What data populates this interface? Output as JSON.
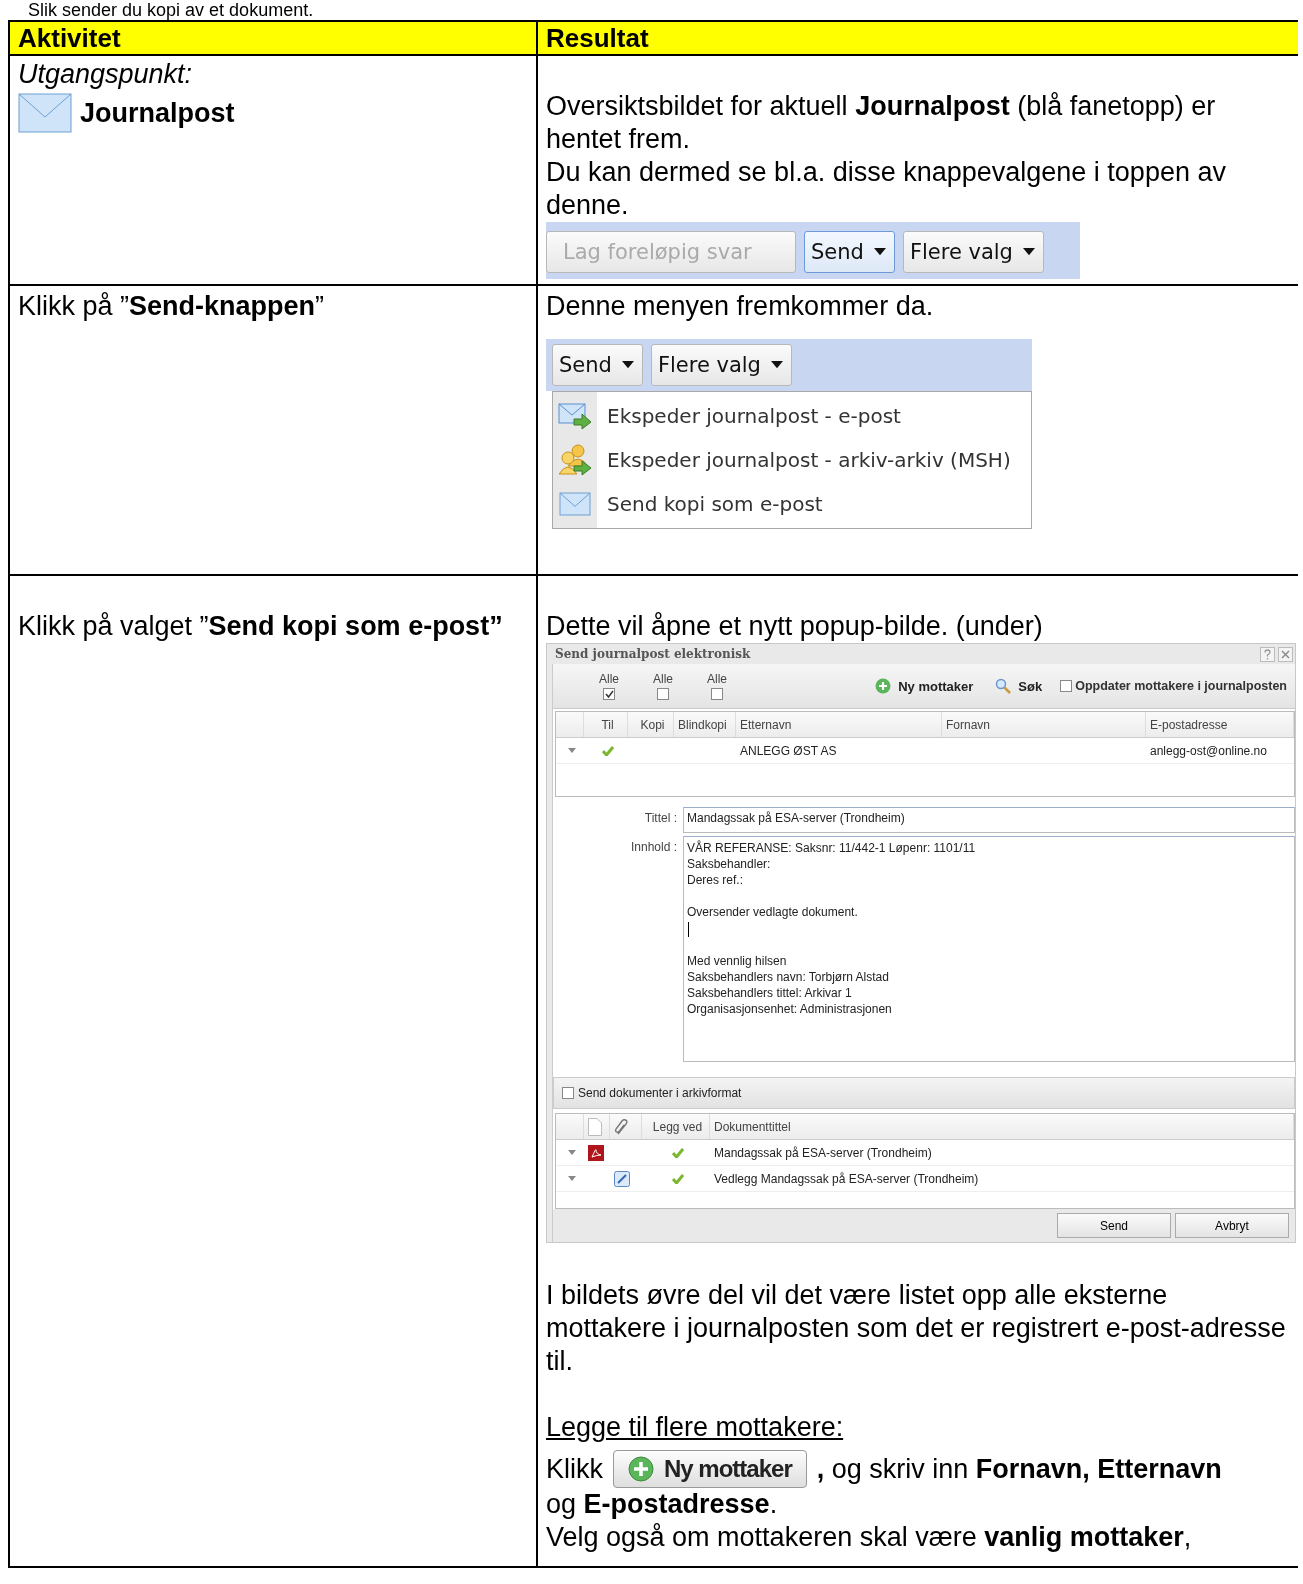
{
  "intro": "Slik sender du kopi av et dokument.",
  "table": {
    "columns": [
      "Aktivitet",
      "Resultat"
    ],
    "rows": [
      {
        "kind": "start",
        "activity": {
          "label": "Utgangspunkt:",
          "item": "Journalpost"
        },
        "result": {
          "paragraphs": [
            "Oversiktsbildet for aktuell **Journalpost** (blå fanetopp) er hentet frem.",
            "Du kan dermed se bl.a. disse knappevalgene i toppen av denne."
          ],
          "toolbar": [
            {
              "label": "Lag foreløpig svar",
              "disabled": true,
              "focused": false,
              "dropdown": false
            },
            {
              "label": "Send",
              "disabled": false,
              "focused": true,
              "dropdown": true
            },
            {
              "label": "Flere valg",
              "disabled": false,
              "focused": false,
              "dropdown": true
            }
          ]
        }
      },
      {
        "kind": "menu",
        "activity": {
          "text": "Klikk på ”**Send-knappen**”"
        },
        "result": {
          "paragraphs": [
            "Denne menyen fremkommer da."
          ],
          "toolbar": [
            {
              "label": "Send",
              "dropdown": true
            },
            {
              "label": "Flere valg",
              "dropdown": true
            }
          ],
          "menu": [
            {
              "kind": "mail-send",
              "label": "Ekspeder journalpost - e-post"
            },
            {
              "kind": "archive-send",
              "label": "Ekspeder journalpost - arkiv-arkiv (MSH)"
            },
            {
              "kind": "mail",
              "label": "Send kopi som e-post"
            }
          ]
        }
      },
      {
        "kind": "dialog",
        "activity": {
          "text": "Klikk på valget ”**Send kopi som e-post”**"
        },
        "result": {
          "paragraphs": [
            "Dette vil åpne et nytt popup-bilde. (under)"
          ],
          "dialog": {
            "title": "Send journalpost elektronisk",
            "select_all": [
              {
                "label": "Alle",
                "checked": true
              },
              {
                "label": "Alle",
                "checked": false
              },
              {
                "label": "Alle",
                "checked": false
              }
            ],
            "actions": [
              {
                "kind": "add",
                "label": "Ny mottaker"
              },
              {
                "kind": "search",
                "label": "Søk"
              }
            ],
            "update_recipients": {
              "label": "Oppdater mottakere i journalposten",
              "checked": false
            },
            "recipients": {
              "columns": [
                "Til",
                "Kopi",
                "Blindkopi",
                "Etternavn",
                "Fornavn",
                "E-postadresse"
              ],
              "rows": [
                {
                  "to": true,
                  "last_name": "ANLEGG ØST AS",
                  "email": "anlegg-ost@online.no"
                }
              ]
            },
            "title_field": {
              "label": "Tittel :",
              "value": "Mandagssak på ESA-server (Trondheim)"
            },
            "content_field": {
              "label": "Innhold :",
              "blocks": [
                [
                  "VÅR REFERANSE: Saksnr: 11/442-1 Løpenr: 1101/11",
                  "Saksbehandler:",
                  "Deres ref.:"
                ],
                [
                  "Oversender vedlagte dokument."
                ],
                [
                  "Med vennlig hilsen",
                  "Saksbehandlers navn: Torbjørn Alstad",
                  "Saksbehandlers tittel: Arkivar 1",
                  "Organisasjonsenhet: Administrasjonen"
                ]
              ]
            },
            "archive_format": {
              "label": "Send dokumenter i arkivformat",
              "checked": false
            },
            "documents": {
              "columns": [
                "Legg ved",
                "Dokumenttittel"
              ],
              "rows": [
                {
                  "kind": "pdf",
                  "attached": true,
                  "title": "Mandagssak på ESA-server (Trondheim)"
                },
                {
                  "kind": "attachment",
                  "attached": true,
                  "title": "Vedlegg Mandagssak på ESA-server (Trondheim)"
                }
              ]
            },
            "buttons": [
              "Send",
              "Avbryt"
            ]
          },
          "after": [
            "I bildets øvre del vil det være listet opp alle eksterne mottakere i journalposten som det er registrert e-post-adresse til."
          ],
          "heading": "Legge til flere mottakere:",
          "instruction": {
            "before": "Klikk",
            "button": "Ny mottaker",
            "after": "**,** og skriv inn **Fornavn, Etternavn**",
            "continuation": "og **E-postadresse**."
          },
          "last": "Velg også om mottakeren skal være **vanlig mottaker**,"
        }
      }
    ]
  }
}
